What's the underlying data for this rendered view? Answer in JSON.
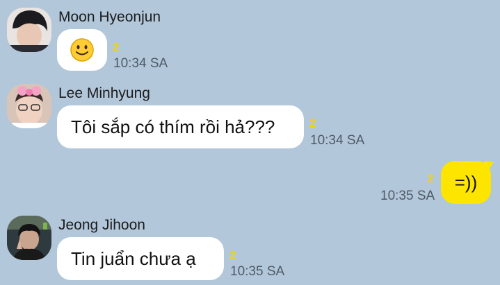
{
  "messages": [
    {
      "sender": "Moon Hyeonjun",
      "avatar_icon": "avatar-moon-hyeonjun",
      "text": "",
      "emoji_icon": "slightly-smiling-face-icon",
      "unread": "2",
      "time": "10:34 SA",
      "side": "left"
    },
    {
      "sender": "Lee Minhyung",
      "avatar_icon": "avatar-lee-minhyung",
      "text": "Tôi sắp có thím rồi hả???",
      "unread": "2",
      "time": "10:34 SA",
      "side": "left"
    },
    {
      "sender": "",
      "text": "=))",
      "unread": "2",
      "time": "10:35 SA",
      "side": "right"
    },
    {
      "sender": "Jeong Jihoon",
      "avatar_icon": "avatar-jeong-jihoon",
      "text": "Tin juẩn chưa ạ",
      "unread": "2",
      "time": "10:35 SA",
      "side": "left"
    }
  ],
  "colors": {
    "background": "#b2c7da",
    "incoming_bubble": "#ffffff",
    "outgoing_bubble": "#fee500",
    "unread_count": "#f2d600",
    "timestamp": "#4f5a66"
  }
}
